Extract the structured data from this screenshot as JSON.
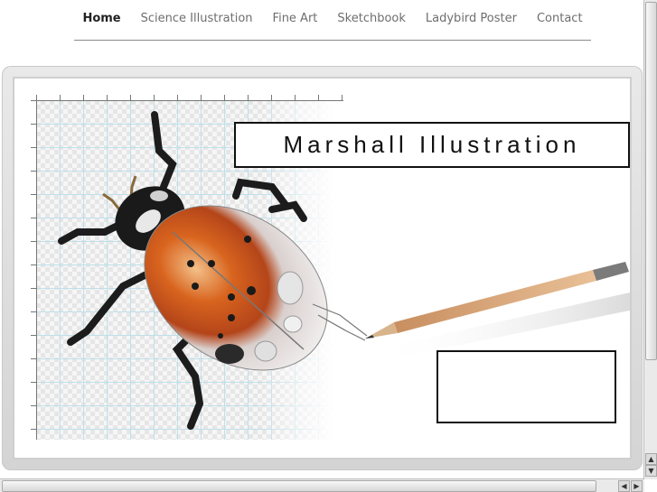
{
  "nav": {
    "items": [
      "Home",
      "Science Illustration",
      "Fine Art",
      "Sketchbook",
      "Ladybird Poster",
      "Contact"
    ],
    "active": "Home"
  },
  "banner": {
    "title": "Marshall Illustration",
    "image": "ladybird-beetle-and-pencil-illustration"
  },
  "colors": {
    "ladybird_orange": "#c8561e",
    "frame_grey": "#d6d6d6",
    "grid_blue": "#bfe0ea"
  },
  "scrollbars": {
    "up_arrow": "▲",
    "down_arrow": "▼",
    "left_arrow": "◀",
    "right_arrow": "▶"
  }
}
